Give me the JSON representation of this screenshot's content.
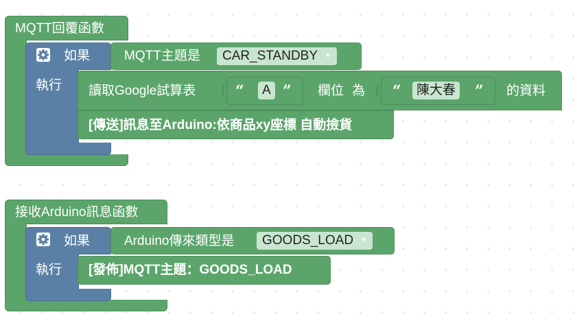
{
  "block1": {
    "title": "MQTT回覆函數",
    "if_label": "如果",
    "do_label": "執行",
    "condition_label": "MQTT主題是",
    "condition_value": "CAR_STANDBY",
    "read_label": "讀取Google試算表",
    "column_value": "A",
    "field_label": "欄位",
    "equals_label": "為",
    "name_value": "陳大春",
    "data_label": "的資料",
    "send_label": "[傳送]訊息至Arduino:依商品xy座標 自動撿貨"
  },
  "block2": {
    "title": "接收Arduino訊息函數",
    "if_label": "如果",
    "do_label": "執行",
    "condition_label": "Arduino傳來類型是",
    "condition_value": "GOODS_LOAD",
    "publish_label": "[發佈]MQTT主題：GOODS_LOAD"
  },
  "icons": {
    "settings": "gear-icon",
    "dropdown": "triangle-down-icon"
  },
  "colors": {
    "procedure_green": "#5ba56b",
    "control_blue": "#5b80a5",
    "field_bg": "#c8e6cf"
  }
}
